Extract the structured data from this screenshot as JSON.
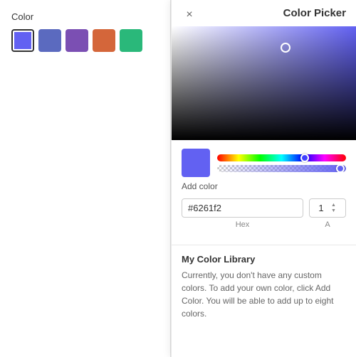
{
  "left": {
    "color_label": "Color",
    "swatches": [
      {
        "id": "swatch-1",
        "color": "#6261f2",
        "selected": true
      },
      {
        "id": "swatch-2",
        "color": "#5b6abf",
        "selected": false
      },
      {
        "id": "swatch-3",
        "color": "#7b4fb3",
        "selected": false
      },
      {
        "id": "swatch-4",
        "color": "#d4663a",
        "selected": false
      },
      {
        "id": "swatch-5",
        "color": "#2ab87a",
        "selected": false
      }
    ]
  },
  "picker": {
    "title": "Color Picker",
    "close_icon": "×",
    "hex_value": "#6261f2",
    "alpha_value": "1",
    "hex_label": "Hex",
    "alpha_label": "A",
    "add_color_label": "Add color",
    "library_title": "My Color Library",
    "library_empty": "Currently, you don't have any custom colors. To add your own color, click Add Color. You will be able to add up to eight colors."
  }
}
